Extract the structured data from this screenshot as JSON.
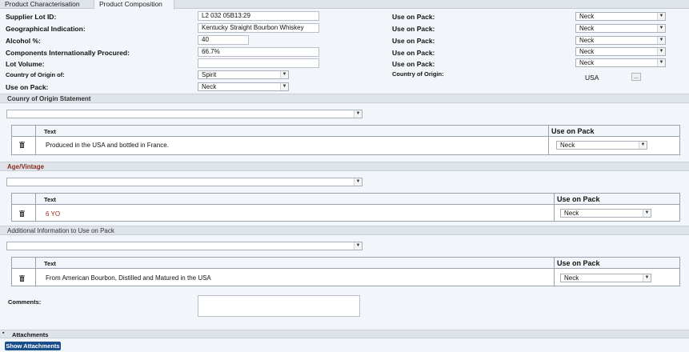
{
  "tabs": [
    "Product Characterisation",
    "Product Composition"
  ],
  "fields": {
    "supplier_lot_id": {
      "label": "Supplier Lot ID:",
      "value": "L2 032 05B13:29"
    },
    "geo_indication": {
      "label": "Geographical Indication:",
      "value": "Kentucky Straight Bourbon Whiskey"
    },
    "alcohol": {
      "label": "Alcohol %:",
      "value": "40"
    },
    "components": {
      "label": "Components Internationally Procured:",
      "value": "66.7%"
    },
    "lot_volume": {
      "label": "Lot Volume:",
      "value": ""
    },
    "country_of_origin_of": {
      "label": "Country of Origin  of:",
      "value": "Spirit"
    },
    "use_on_pack_left": {
      "label": "Use on Pack:",
      "value": "Neck"
    }
  },
  "right_use_on_pack": {
    "label": "Use on Pack:",
    "values": [
      "Neck",
      "Neck",
      "Neck",
      "Neck",
      "Neck"
    ]
  },
  "country_of_origin": {
    "label": "Country of Origin:",
    "value": "USA",
    "button": "..."
  },
  "sections": {
    "country_statement": {
      "title": "Counry of Origin Statement",
      "col_text": "Text",
      "col_pack": "Use on Pack",
      "row_text": "Produced in the USA and bottled in France.",
      "row_pack": "Neck"
    },
    "age_vintage": {
      "title": "Age/Vintage",
      "col_text": "Text",
      "col_pack": "Use on Pack",
      "row_text": "6 YO",
      "row_pack": "Neck"
    },
    "additional_info": {
      "title": "Additional Information to Use on Pack",
      "col_text": "Text",
      "col_pack": "Use on Pack",
      "row_text": "From American Bourbon, Distilled and Matured in the USA",
      "row_pack": "Neck"
    }
  },
  "comments": {
    "label": "Comments:",
    "value": ""
  },
  "attachments": {
    "label": "Attachments",
    "button": "Show Attachments"
  },
  "icons": {
    "trash": "trash-icon",
    "dropdown": "chevron-down-icon",
    "collapse": "minus-icon"
  },
  "colors": {
    "section_title_red": "#8b2a1d",
    "button_blue": "#1b4f8c"
  }
}
